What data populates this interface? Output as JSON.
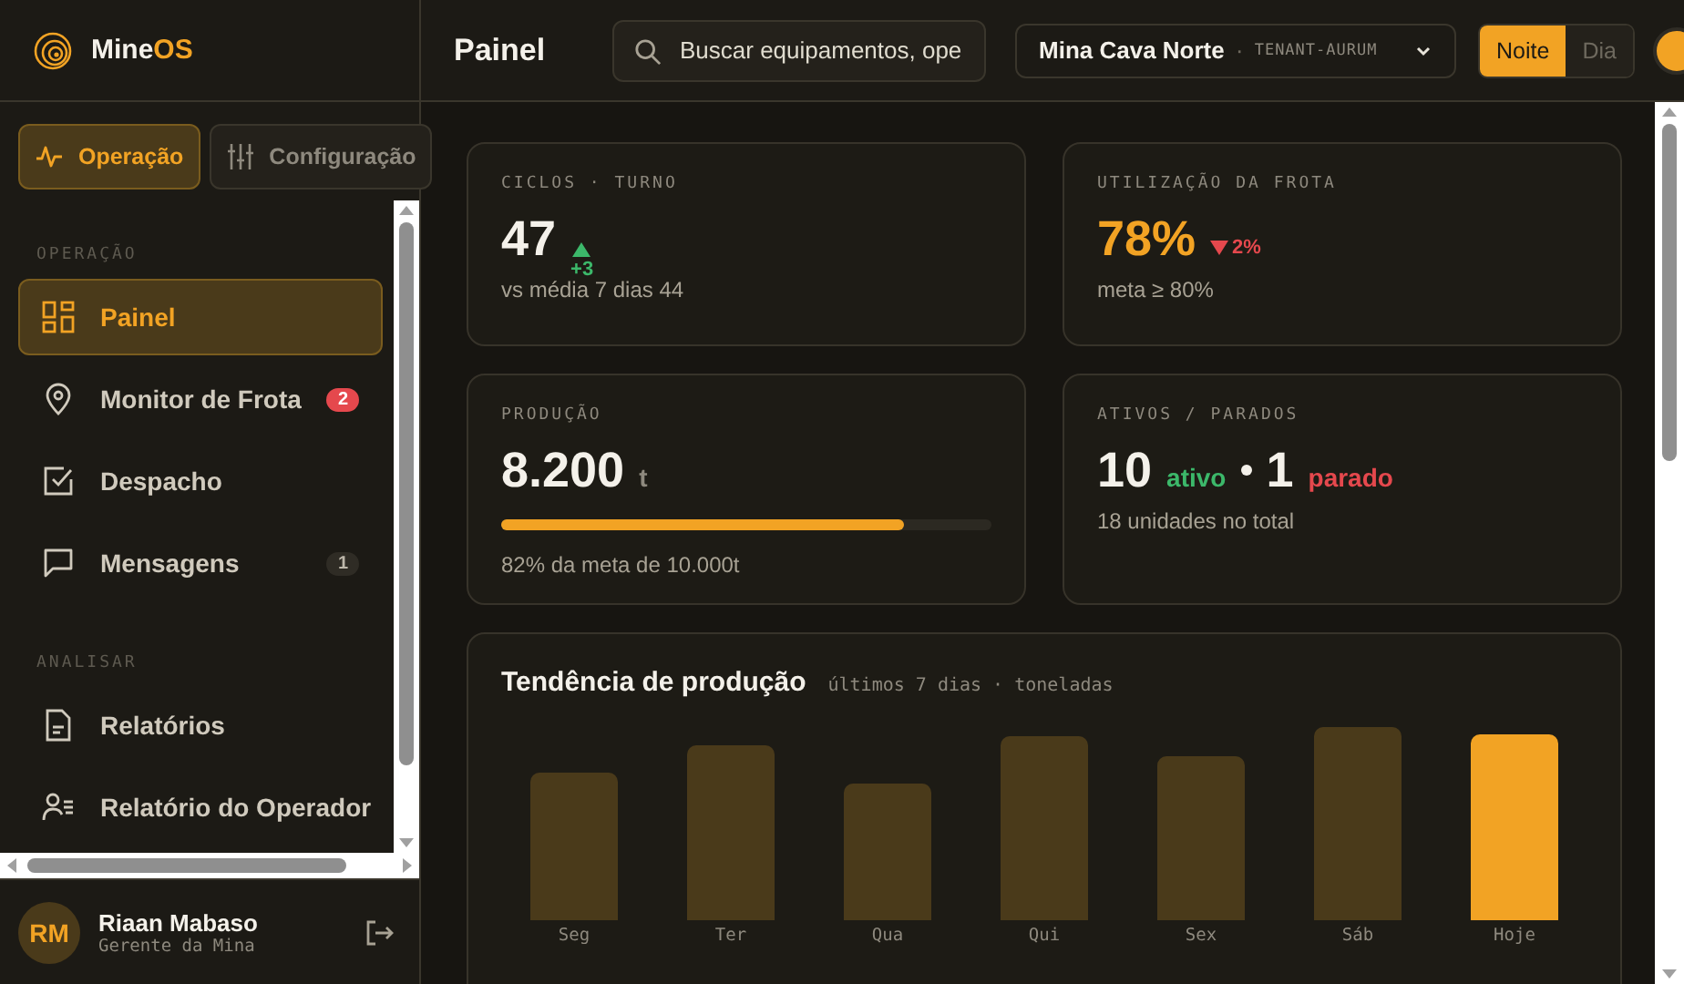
{
  "brand": {
    "name": "Mine",
    "accent": "OS"
  },
  "mode_tabs": [
    {
      "label": "Operação",
      "selected": true
    },
    {
      "label": "Configuração",
      "selected": false
    }
  ],
  "nav_sections": [
    {
      "title": "OPERAÇÃO",
      "items": [
        {
          "label": "Painel",
          "selected": true
        },
        {
          "label": "Monitor de Frota",
          "selected": false,
          "badge": {
            "text": "2",
            "kind": "alert"
          }
        },
        {
          "label": "Despacho",
          "selected": false
        },
        {
          "label": "Mensagens",
          "selected": false,
          "badge": {
            "text": "1",
            "kind": "count"
          }
        }
      ]
    },
    {
      "title": "ANALISAR",
      "items": [
        {
          "label": "Relatórios",
          "selected": false
        },
        {
          "label": "Relatório do Operador",
          "selected": false
        }
      ]
    }
  ],
  "user": {
    "initials": "RM",
    "name": "Riaan Mabaso",
    "role": "Gerente da Mina"
  },
  "header": {
    "title": "Painel",
    "search": {
      "placeholder": "Buscar equipamentos, ope"
    },
    "site": {
      "name": "Mina Cava Norte",
      "separator": "·",
      "tenant": "TENANT-AURUM"
    },
    "theme_options": [
      {
        "label": "Noite",
        "selected": true
      },
      {
        "label": "Dia",
        "selected": false
      }
    ]
  },
  "cycles": {
    "label": "CICLOS · TURNO",
    "value": "47",
    "delta": {
      "text": "+3",
      "rising": true
    },
    "note": "vs média 7 dias 44"
  },
  "utilization": {
    "label": "UTILIZAÇÃO DA FROTA",
    "value": "78%",
    "highlight": true,
    "delta": {
      "text": "2%",
      "rising": false
    },
    "note": "meta ≥ 80%"
  },
  "production": {
    "label": "PRODUÇÃO",
    "value": "8.200",
    "unit": "t",
    "level": 0.82,
    "note": "82% da meta de 10.000t"
  },
  "assets": {
    "label": "ATIVOS / PARADOS",
    "active": "10",
    "active_label": "ativo",
    "idle": "1",
    "idle_label": "parado",
    "note": "18 unidades no total"
  },
  "trend": {
    "title": "Tendência de produção",
    "subtitle": "últimos 7 dias · toneladas",
    "days": [
      {
        "label": "Seg",
        "selected": false
      },
      {
        "label": "Ter",
        "selected": false
      },
      {
        "label": "Qua",
        "selected": false
      },
      {
        "label": "Qui",
        "selected": false
      },
      {
        "label": "Sex",
        "selected": false
      },
      {
        "label": "Sáb",
        "selected": false
      },
      {
        "label": "Hoje",
        "selected": true
      }
    ]
  }
}
